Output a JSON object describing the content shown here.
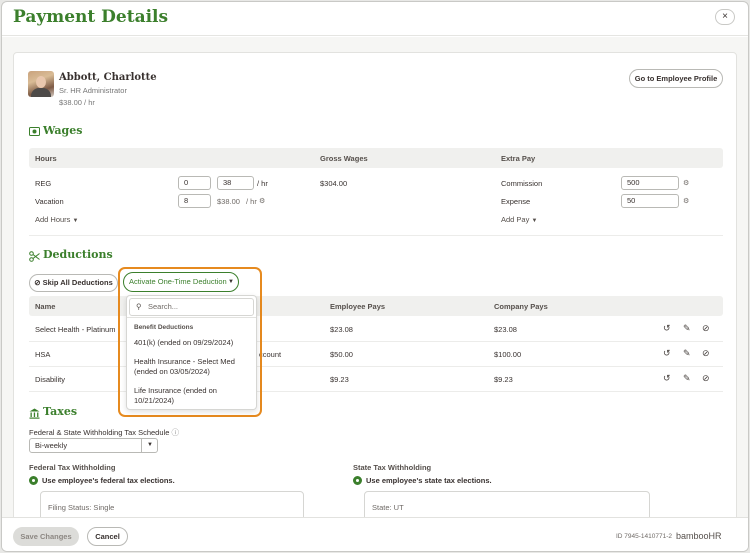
{
  "header": {
    "title": "Payment Details",
    "close_symbol": "×"
  },
  "employee": {
    "name": "Abbott, Charlotte",
    "job_title": "Sr. HR Administrator",
    "rate": "$38.00 / hr",
    "profile_button": "Go to Employee Profile"
  },
  "wages": {
    "title": "Wages",
    "columns": {
      "hours": "Hours",
      "gross": "Gross Wages",
      "extra": "Extra Pay"
    },
    "rows": [
      {
        "label": "REG",
        "hours": "0",
        "rate_value": "38",
        "rate_unit": "/ hr",
        "gross": "$304.00"
      },
      {
        "label": "Vacation",
        "hours": "8",
        "rate_value": "$38.00",
        "rate_unit": "/ hr",
        "gross": ""
      }
    ],
    "extra": [
      {
        "label": "Commission",
        "value": "500"
      },
      {
        "label": "Expense",
        "value": "50"
      }
    ],
    "add_hours": "Add Hours",
    "add_pay": "Add Pay"
  },
  "deductions": {
    "title": "Deductions",
    "skip_button": "Skip All Deductions",
    "activate_button": "Activate One-Time Deduction",
    "columns": {
      "name": "Name",
      "employee": "Employee Pays",
      "company": "Company Pays"
    },
    "rows": [
      {
        "name": "Select Health - Platinum",
        "mid": "",
        "employee": "$23.08",
        "company": "$23.08"
      },
      {
        "name": "HSA",
        "mid": "ccount",
        "employee": "$50.00",
        "company": "$100.00"
      },
      {
        "name": "Disability",
        "mid": "",
        "employee": "$9.23",
        "company": "$9.23"
      }
    ],
    "menu": {
      "search_placeholder": "Search...",
      "group_label": "Benefit Deductions",
      "items": [
        "401(k) (ended on 09/29/2024)",
        "Health Insurance - Select Med (ended on 03/05/2024)",
        "Life Insurance (ended on 10/21/2024)"
      ]
    }
  },
  "taxes": {
    "title": "Taxes",
    "schedule_label": "Federal & State Withholding Tax Schedule",
    "schedule_value": "Bi-weekly",
    "federal": {
      "title": "Federal Tax Withholding",
      "option": "Use employee's federal tax elections.",
      "status": "Filing Status: Single"
    },
    "state": {
      "title": "State Tax Withholding",
      "option": "Use employee's state tax elections.",
      "status": "State: UT"
    }
  },
  "footer": {
    "save": "Save Changes",
    "cancel": "Cancel",
    "id_text": "ID 7945-1410771-2",
    "brand": "bambooHR"
  },
  "colors": {
    "accent": "#3b7f2c",
    "highlight": "#e68a1f"
  }
}
